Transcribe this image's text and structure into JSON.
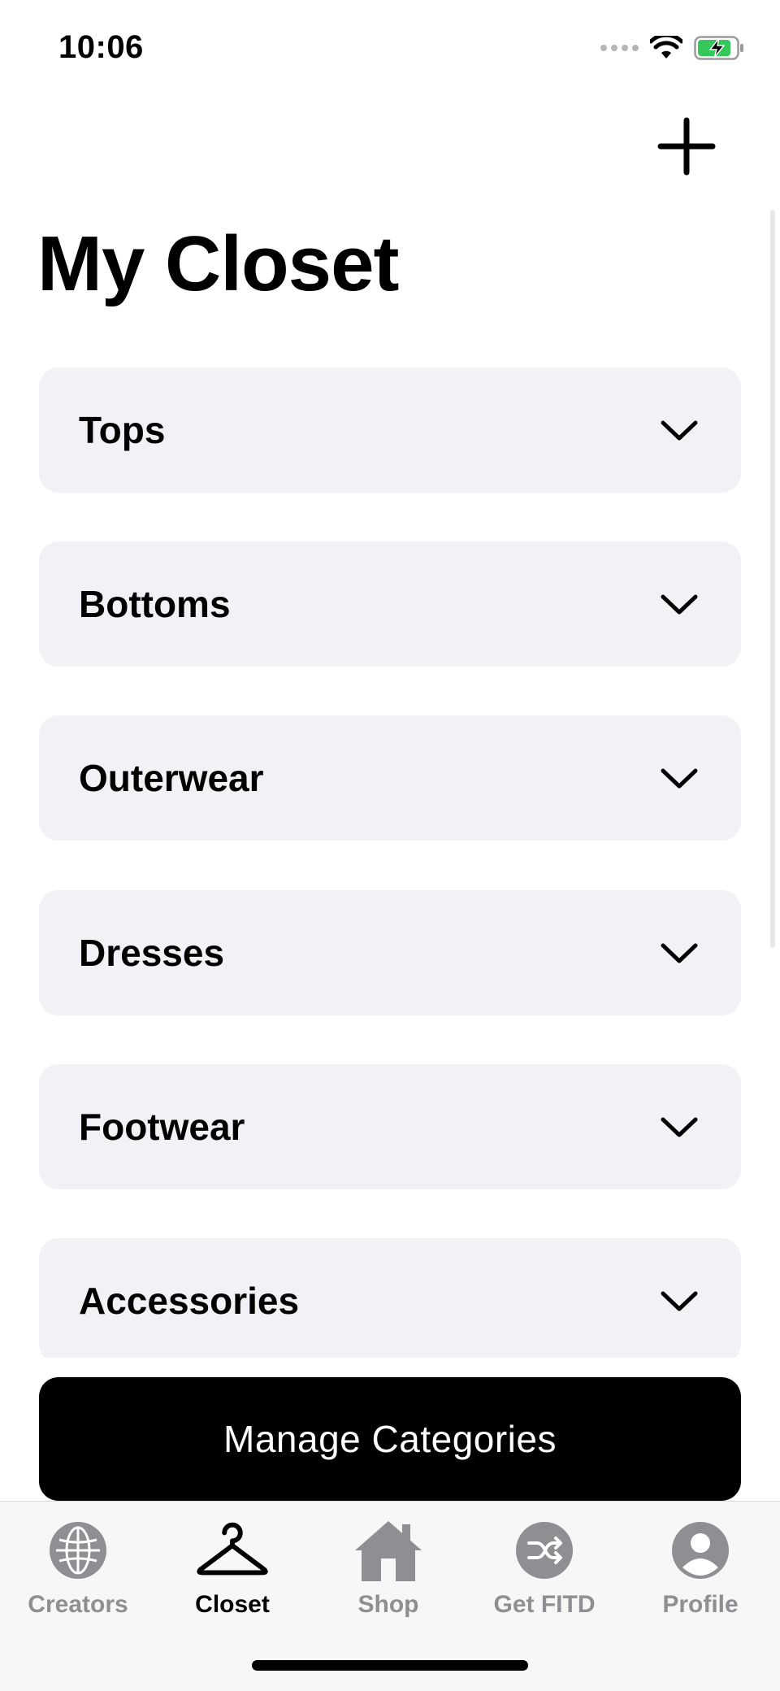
{
  "status_bar": {
    "time": "10:06"
  },
  "header": {
    "add_icon": "plus-icon",
    "title": "My Closet"
  },
  "categories": [
    {
      "label": "Tops",
      "icon": "chevron-down-icon"
    },
    {
      "label": "Bottoms",
      "icon": "chevron-down-icon"
    },
    {
      "label": "Outerwear",
      "icon": "chevron-down-icon"
    },
    {
      "label": "Dresses",
      "icon": "chevron-down-icon"
    },
    {
      "label": "Footwear",
      "icon": "chevron-down-icon"
    },
    {
      "label": "Accessories",
      "icon": "chevron-down-icon"
    }
  ],
  "manage_button": {
    "label": "Manage Categories"
  },
  "tab_bar": {
    "active": "Closet",
    "items": [
      {
        "label": "Creators",
        "icon": "globe-icon"
      },
      {
        "label": "Closet",
        "icon": "hanger-icon"
      },
      {
        "label": "Shop",
        "icon": "house-icon"
      },
      {
        "label": "Get FITD",
        "icon": "shuffle-icon"
      },
      {
        "label": "Profile",
        "icon": "person-icon"
      }
    ]
  },
  "colors": {
    "card_background": "#f1f1f6",
    "button_background": "#000000",
    "tab_inactive": "#8e8e93",
    "tab_active": "#000000",
    "battery_charge": "#34c759"
  }
}
